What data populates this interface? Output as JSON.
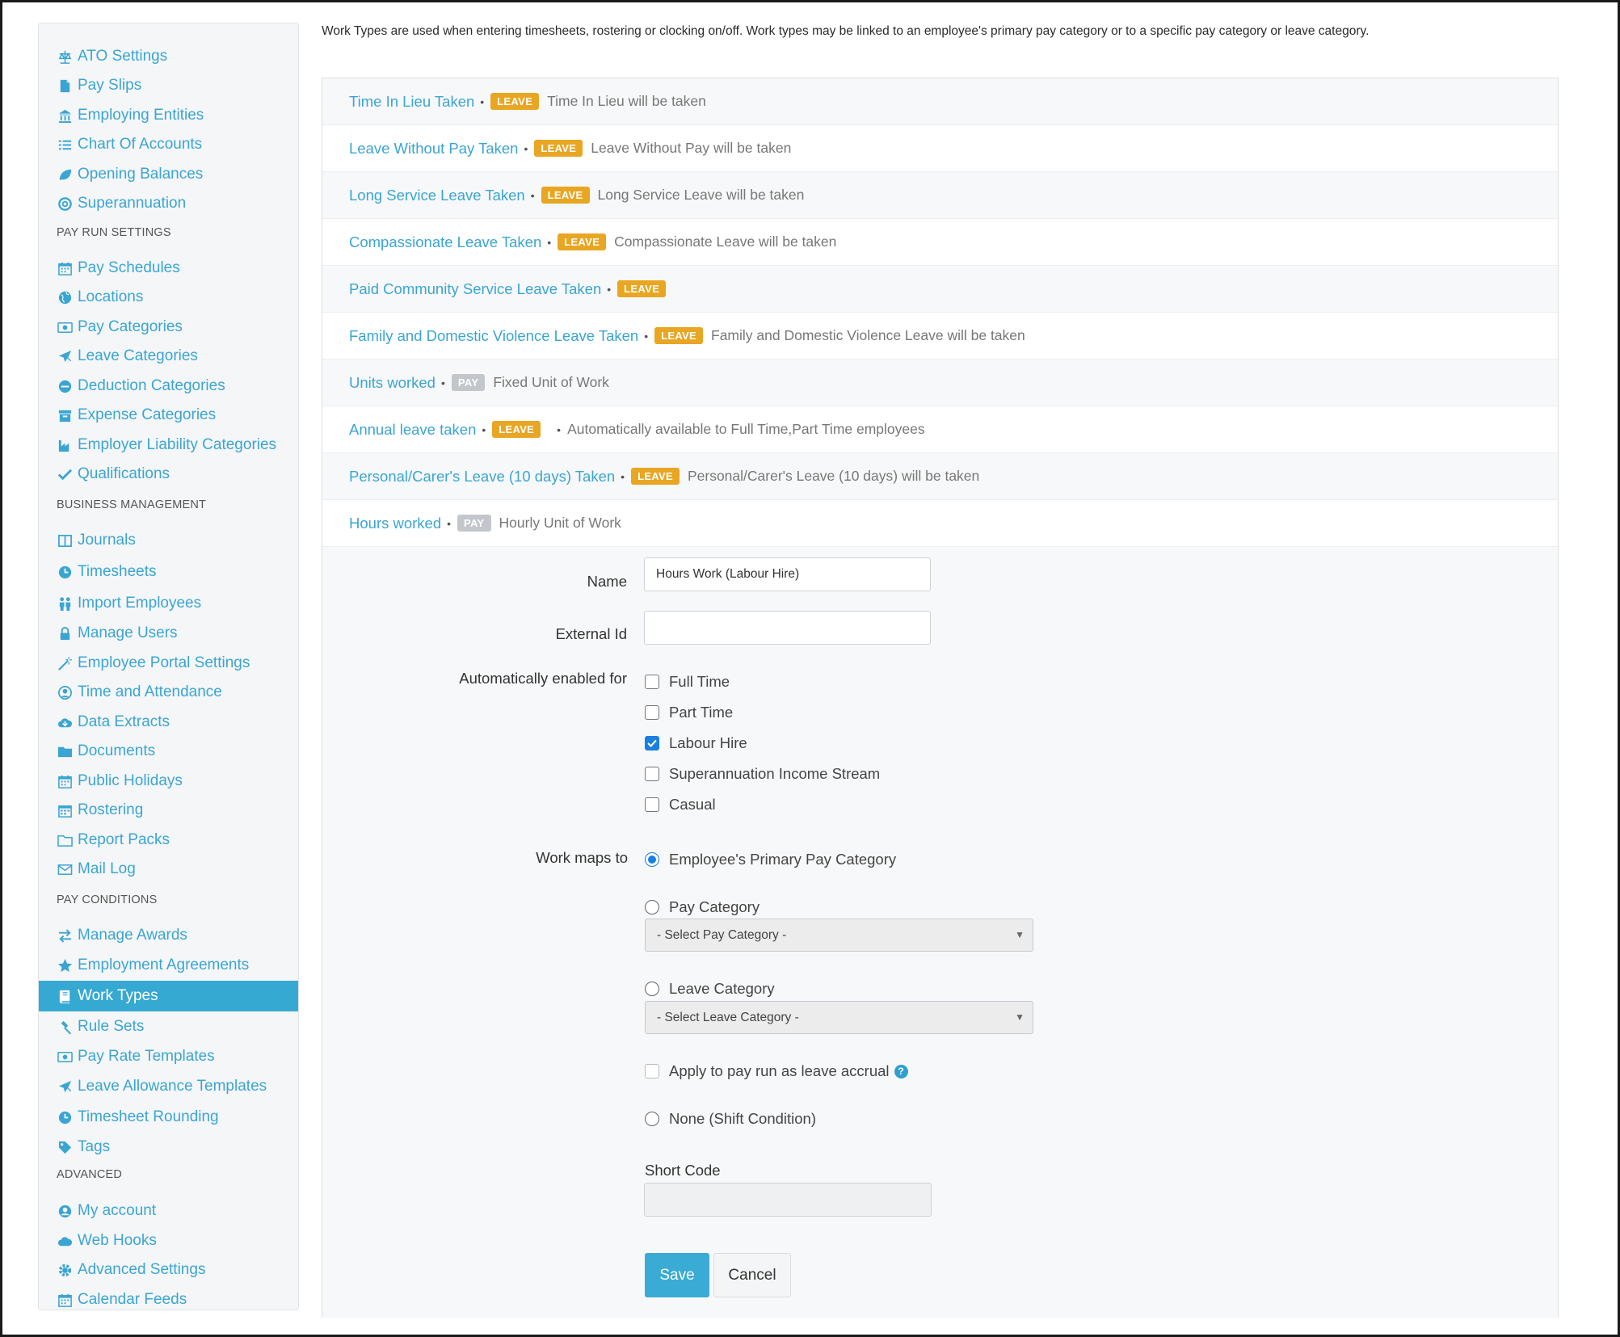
{
  "sidebar": {
    "sections": [
      {
        "heading": "",
        "items": [
          {
            "label": "ATO Settings",
            "icon": "balance-scale-icon"
          },
          {
            "label": "Pay Slips",
            "icon": "file-icon"
          },
          {
            "label": "Employing Entities",
            "icon": "bank-icon"
          },
          {
            "label": "Chart Of Accounts",
            "icon": "list-icon"
          },
          {
            "label": "Opening Balances",
            "icon": "leaf-icon"
          },
          {
            "label": "Superannuation",
            "icon": "life-ring-icon"
          }
        ]
      },
      {
        "heading": "PAY RUN SETTINGS",
        "items": [
          {
            "label": "Pay Schedules",
            "icon": "calendar-icon"
          },
          {
            "label": "Locations",
            "icon": "globe-icon"
          },
          {
            "label": "Pay Categories",
            "icon": "money-icon"
          },
          {
            "label": "Leave Categories",
            "icon": "plane-icon"
          },
          {
            "label": "Deduction Categories",
            "icon": "minus-circle-icon"
          },
          {
            "label": "Expense Categories",
            "icon": "archive-icon"
          },
          {
            "label": "Employer Liability Categories",
            "icon": "industry-icon"
          },
          {
            "label": "Qualifications",
            "icon": "check-icon"
          }
        ]
      },
      {
        "heading": "BUSINESS MANAGEMENT",
        "items": [
          {
            "label": "Journals",
            "icon": "columns-icon"
          },
          {
            "label": "Timesheets",
            "icon": "clock-icon"
          },
          {
            "label": "Import Employees",
            "icon": "users-icon"
          },
          {
            "label": "Manage Users",
            "icon": "lock-icon"
          },
          {
            "label": "Employee Portal Settings",
            "icon": "magic-wand-icon"
          },
          {
            "label": "Time and Attendance",
            "icon": "user-clock-icon"
          },
          {
            "label": "Data Extracts",
            "icon": "cloud-download-icon"
          },
          {
            "label": "Documents",
            "icon": "folder-icon"
          },
          {
            "label": "Public Holidays",
            "icon": "calendar-icon"
          },
          {
            "label": "Rostering",
            "icon": "calendar-grid-icon"
          },
          {
            "label": "Report Packs",
            "icon": "folder-open-icon"
          },
          {
            "label": "Mail Log",
            "icon": "envelope-icon"
          }
        ]
      },
      {
        "heading": "PAY CONDITIONS",
        "items": [
          {
            "label": "Manage Awards",
            "icon": "exchange-icon"
          },
          {
            "label": "Employment Agreements",
            "icon": "star-icon"
          },
          {
            "label": "Work Types",
            "icon": "book-icon",
            "active": true
          },
          {
            "label": "Rule Sets",
            "icon": "gavel-icon"
          },
          {
            "label": "Pay Rate Templates",
            "icon": "money-icon"
          },
          {
            "label": "Leave Allowance Templates",
            "icon": "plane-icon"
          },
          {
            "label": "Timesheet Rounding",
            "icon": "clock-icon"
          },
          {
            "label": "Tags",
            "icon": "tag-icon"
          }
        ]
      },
      {
        "heading": "ADVANCED",
        "items": [
          {
            "label": "My account",
            "icon": "user-circle-icon"
          },
          {
            "label": "Web Hooks",
            "icon": "cloud-icon"
          },
          {
            "label": "Advanced Settings",
            "icon": "cog-icon"
          },
          {
            "label": "Calendar Feeds",
            "icon": "calendar-icon"
          }
        ]
      }
    ]
  },
  "main": {
    "intro": "Work Types are used when entering timesheets, rostering or clocking on/off. Work types may be linked to an employee's primary pay category or to a specific pay category or leave category.",
    "work_types": [
      {
        "name": "Time In Lieu Taken",
        "badge": "LEAVE",
        "description": "Time In Lieu will be taken"
      },
      {
        "name": "Leave Without Pay Taken",
        "badge": "LEAVE",
        "description": "Leave Without Pay will be taken"
      },
      {
        "name": "Long Service Leave Taken",
        "badge": "LEAVE",
        "description": "Long Service Leave will be taken"
      },
      {
        "name": "Compassionate Leave Taken",
        "badge": "LEAVE",
        "description": "Compassionate Leave will be taken"
      },
      {
        "name": "Paid Community Service Leave Taken",
        "badge": "LEAVE",
        "description": ""
      },
      {
        "name": "Family and Domestic Violence Leave Taken",
        "badge": "LEAVE",
        "description": "Family and Domestic Violence Leave will be taken"
      },
      {
        "name": "Units worked",
        "badge": "PAY",
        "description": "Fixed Unit of Work"
      },
      {
        "name": "Annual leave taken",
        "badge": "LEAVE",
        "description": "",
        "extra": "Automatically available to Full Time,Part Time employees"
      },
      {
        "name": "Personal/Carer's Leave (10 days) Taken",
        "badge": "LEAVE",
        "description": "Personal/Carer's Leave (10 days) will be taken"
      },
      {
        "name": "Hours worked",
        "badge": "PAY",
        "description": "Hourly Unit of Work"
      }
    ],
    "form": {
      "name_label": "Name",
      "name_value": "Hours Work (Labour Hire)",
      "external_id_label": "External Id",
      "external_id_value": "",
      "auto_enabled_label": "Automatically enabled for",
      "employment_types": [
        {
          "label": "Full Time",
          "checked": false
        },
        {
          "label": "Part Time",
          "checked": false
        },
        {
          "label": "Labour Hire",
          "checked": true
        },
        {
          "label": "Superannuation Income Stream",
          "checked": false
        },
        {
          "label": "Casual",
          "checked": false
        }
      ],
      "work_maps_label": "Work maps to",
      "map_primary": "Employee's Primary Pay Category",
      "map_pay_category": "Pay Category",
      "pay_category_select": "- Select Pay Category -",
      "map_leave_category": "Leave Category",
      "leave_category_select": "- Select Leave Category -",
      "leave_accrual": "Apply to pay run as leave accrual",
      "help_glyph": "?",
      "map_none": "None (Shift Condition)",
      "short_code_label": "Short Code",
      "short_code_value": "",
      "save": "Save",
      "cancel": "Cancel"
    }
  },
  "colors": {
    "link": "#3aa5d3",
    "active": "#35a9d2",
    "leave_badge": "#e8a623",
    "pay_badge": "#c3c7cc",
    "primary_button": "#3aabd4"
  }
}
